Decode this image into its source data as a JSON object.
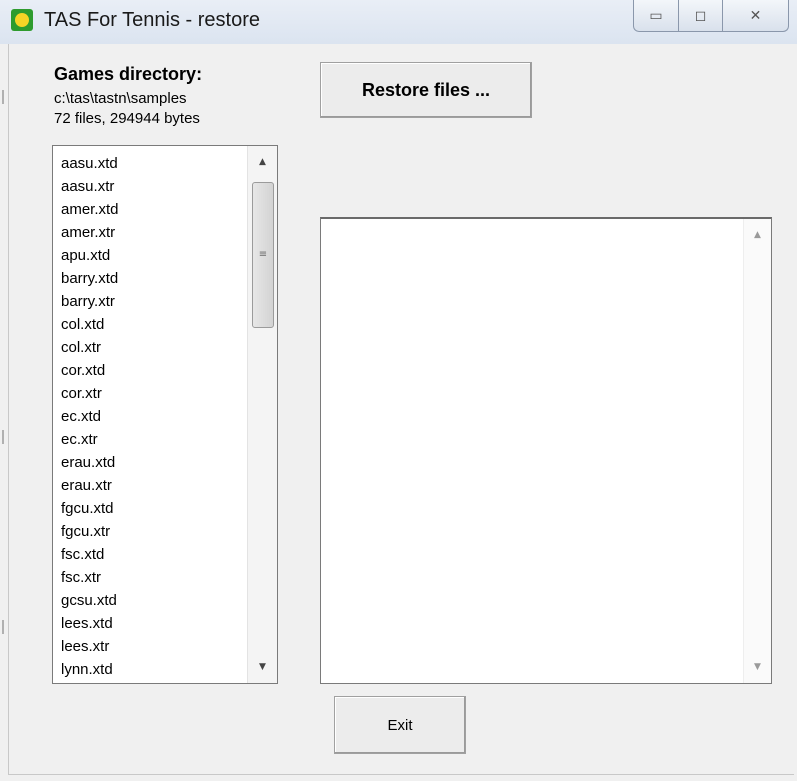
{
  "window": {
    "title": "TAS For Tennis - restore",
    "controls": {
      "minimize_icon": "minimize-icon",
      "maximize_icon": "maximize-icon",
      "close_icon": "close-icon"
    }
  },
  "games": {
    "heading": "Games directory:",
    "directory": "c:\\tas\\tastn\\samples",
    "summary": "72 files, 294944 bytes"
  },
  "buttons": {
    "restore_label": "Restore files ...",
    "exit_label": "Exit"
  },
  "file_list": {
    "items": [
      "aasu.xtd",
      "aasu.xtr",
      "amer.xtd",
      "amer.xtr",
      "apu.xtd",
      "barry.xtd",
      "barry.xtr",
      "col.xtd",
      "col.xtr",
      "cor.xtd",
      "cor.xtr",
      "ec.xtd",
      "ec.xtr",
      "erau.xtd",
      "erau.xtr",
      "fgcu.xtd",
      "fgcu.xtr",
      "fsc.xtd",
      "fsc.xtr",
      "gcsu.xtd",
      "lees.xtd",
      "lees.xtr",
      "lynn.xtd"
    ]
  },
  "output_box": {
    "content": ""
  },
  "colors": {
    "window_bg": "#f0f0f0",
    "app_icon": "#2e9b2e",
    "titlebar": "#dbe4f0"
  }
}
